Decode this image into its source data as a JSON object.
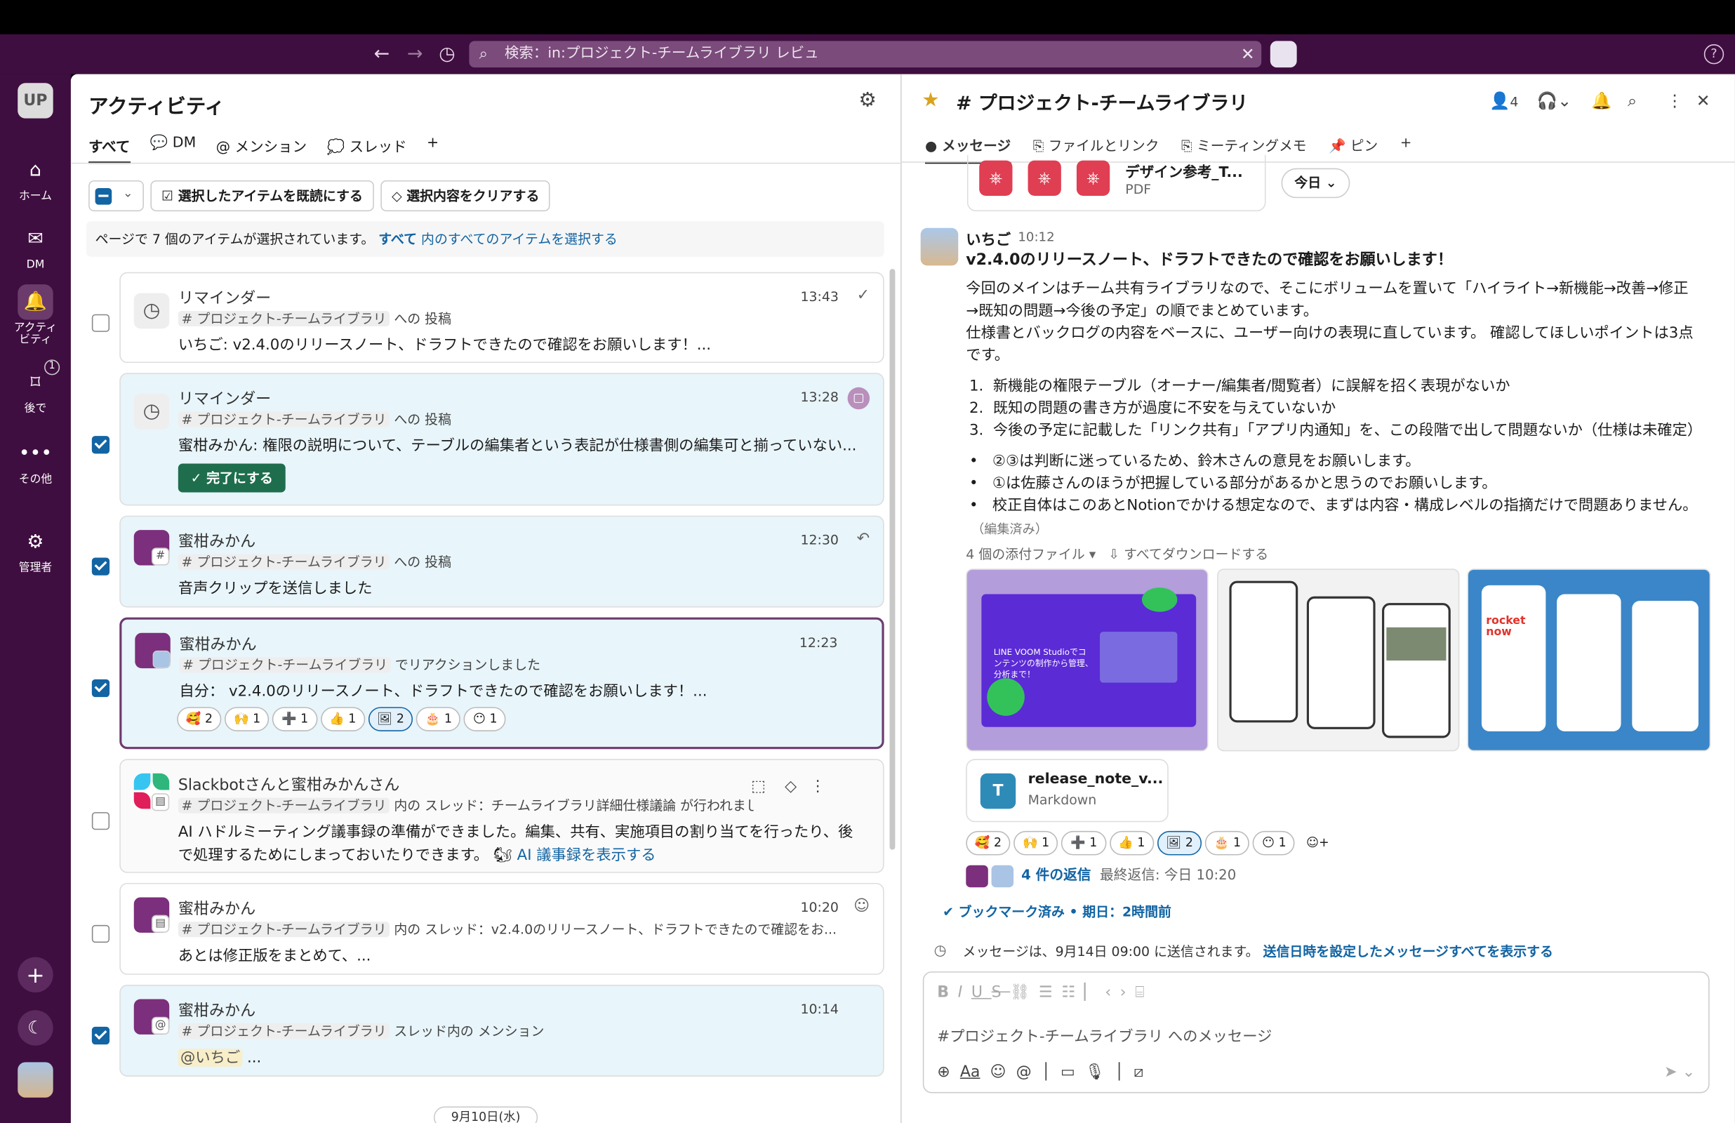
{
  "search": {
    "text": "検索：in:プロジェクト-チームライブラリ レビュ"
  },
  "workspace": "UP",
  "rail": [
    {
      "label": "ホーム"
    },
    {
      "label": "DM"
    },
    {
      "label": "アクティ\nビティ"
    },
    {
      "label": "後で",
      "badge": "1"
    },
    {
      "label": "その他"
    },
    {
      "label": "管理者"
    }
  ],
  "activity": {
    "title": "アクティビティ",
    "tabs": [
      "すべて",
      "DM",
      "メンション",
      "スレッド",
      "+"
    ],
    "mark_read": "選択したアイテムを既読にする",
    "clear_sel": "選択内容をクリアする",
    "sel_text": "ページで 7 個のアイテムが選択されています。",
    "sel_link_a": "すべて",
    "sel_link_b": "内のすべてのアイテムを選択する",
    "done_label": "✓ 完了にする",
    "date_divider": "9月10日(水)",
    "items": [
      {
        "title": "リマインダー",
        "time": "13:43",
        "channel": "# プロジェクト-チームライブラリ",
        "ctx": " への 投稿",
        "body": "いちご: v2.4.0のリリースノート、ドラフトできたので確認をお願いします！..."
      },
      {
        "title": "リマインダー",
        "time": "13:28",
        "channel": "# プロジェクト-チームライブラリ",
        "ctx": " への 投稿",
        "body": "蜜柑みかん: 権限の説明について、テーブルの編集者という表記が仕様書側の編集可と揃っていない..."
      },
      {
        "title": "蜜柑みかん",
        "time": "12:30",
        "channel": "# プロジェクト-チームライブラリ",
        "ctx": " への 投稿",
        "body": "音声クリップを送信しました"
      },
      {
        "title": "蜜柑みかん",
        "time": "12:23",
        "channel": "# プロジェクト-チームライブラリ",
        "ctx": " でリアクションしました",
        "body": "自分： v2.4.0のリリースノート、ドラフトできたので確認をお願いします！..."
      },
      {
        "title": "Slackbotさんと蜜柑みかんさん",
        "channel": "# プロジェクト-チームライブラリ",
        "ctx": " 内の スレッド：チームライブラリ詳細仕様議論 が行われまし...",
        "body": "AI ハドルミーティング議事録の準備ができました。編集、共有、実施項目の割り当てを行ったり、後",
        "body2": "で処理するためにしまっておいたりできます。",
        "link": "AI 議事録を表示する"
      },
      {
        "title": "蜜柑みかん",
        "time": "10:20",
        "channel": "# プロジェクト-チームライブラリ",
        "ctx": " 内の スレッド：v2.4.0のリリースノート、ドラフトできたので確認をお...",
        "body": "あとは修正版をまとめて、..."
      },
      {
        "title": "蜜柑みかん",
        "time": "10:14",
        "channel": "# プロジェクト-チームライブラリ",
        "ctx": " スレッド内の メンション",
        "body": "@いちご",
        "body_tail": " ..."
      }
    ],
    "reactions": [
      "🥰 2",
      "🙌 1",
      "➕ 1",
      "👍 1",
      "2",
      "1",
      "1"
    ]
  },
  "channel": {
    "title": "# プロジェクト-チームライブラリ",
    "members": "4",
    "tabs": [
      "メッセージ",
      "ファイルとリンク",
      "ミーティングメモ",
      "ピン",
      "+"
    ],
    "file_name": "デザイン参考_T...",
    "file_type": "PDF",
    "today": "今日",
    "msg": {
      "author": "いちご",
      "time": "10:12",
      "headline": "v2.4.0のリリースノート、ドラフトできたので確認をお願いします！",
      "p1a": "今回のメインはチーム共有ライブラリなので、そこにボリュームを置いて「ハイライト→新機能→改善→修正",
      "p1b": "→既知の問題→今後の予定」の順でまとめています。",
      "p2a": "仕様書とバックログの内容をベースに、ユーザー向けの表現に直しています。 確認してほしいポイントは3点",
      "p2b": "です。",
      "ol": [
        "新機能の権限テーブル（オーナー/編集者/閲覧者）に誤解を招く表現がないか",
        "既知の問題の書き方が過度に不安を与えていないか",
        "今後の予定に記載した「リンク共有」「アプリ内通知」を、この段階で出して問題ないか（仕様は未確定）"
      ],
      "ul": [
        "②③は判断に迷っているため、鈴木さんの意見をお願いします。",
        "①は佐藤さんのほうが把握している部分があるかと思うのでお願いします。",
        "校正自体はこのあとNotionでかける想定なので、まずは内容・構成レベルの指摘だけで問題ありません。"
      ],
      "edited": "（編集済み）",
      "attach_count": "4 個の添付ファイル",
      "download_all": "すべてダウンロードする",
      "md_name": "release_note_v...",
      "md_type": "Markdown",
      "img1_text": "LINE VOOM Studioでコンテンツの制作から管理、分析まで！",
      "img3_text": "rocket now",
      "replies": "4 件の返信",
      "last_reply": "最終返信: 今日 10:20",
      "reactions": [
        "🥰 2",
        "🙌 1",
        "➕ 1",
        "👍 1",
        "2",
        "1",
        "1"
      ]
    },
    "bookmark": "ブックマーク済み • 期日：2時間前",
    "sched_text": "メッセージは、9月14日 09:00 に送信されます。",
    "sched_link": "送信日時を設定したメッセージすべてを表示する",
    "composer_placeholder": "#プロジェクト-チームライブラリ へのメッセージ"
  },
  "colors": {
    "aubergine": "#3f0e40",
    "link": "#1264a3",
    "done": "#1e6e4d",
    "selected_bg": "#e8f5fa"
  }
}
